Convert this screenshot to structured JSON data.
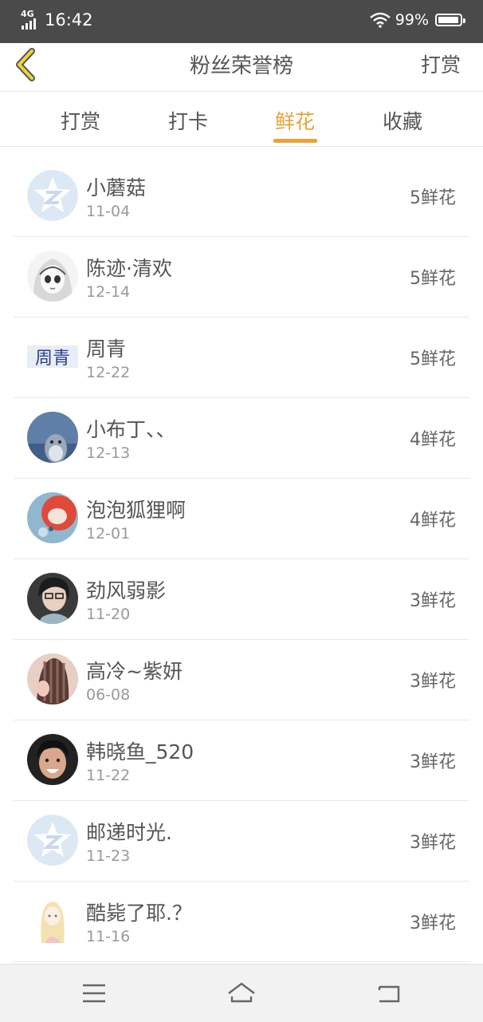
{
  "status_bar": {
    "network": "4G",
    "time": "16:42",
    "battery": "99%"
  },
  "header": {
    "title": "粉丝荣誉榜",
    "action": "打赏"
  },
  "tabs": [
    {
      "label": "打赏",
      "active": false
    },
    {
      "label": "打卡",
      "active": false
    },
    {
      "label": "鲜花",
      "active": true
    },
    {
      "label": "收藏",
      "active": false
    }
  ],
  "accent_color": "#e8a33a",
  "fans": [
    {
      "name": "小蘑菇",
      "date": "11-04",
      "amount": "5鲜花",
      "avatar": "qq-default-avatar"
    },
    {
      "name": "陈迹·清欢",
      "date": "12-14",
      "amount": "5鲜花",
      "avatar": "anime-girl-sketch-avatar"
    },
    {
      "name": "周青",
      "date": "12-22",
      "amount": "5鲜花",
      "avatar": "text-avatar",
      "avatar_text": "周青"
    },
    {
      "name": "小布丁、、",
      "date": "12-13",
      "amount": "4鲜花",
      "avatar": "totoro-avatar"
    },
    {
      "name": "泡泡狐狸啊",
      "date": "12-01",
      "amount": "4鲜花",
      "avatar": "fox-avatar"
    },
    {
      "name": "劲风弱影",
      "date": "11-20",
      "amount": "3鲜花",
      "avatar": "glasses-person-avatar"
    },
    {
      "name": "高冷~紫妍",
      "date": "06-08",
      "amount": "3鲜花",
      "avatar": "braided-hair-avatar"
    },
    {
      "name": "韩晓鱼_520",
      "date": "11-22",
      "amount": "3鲜花",
      "avatar": "smiling-boy-avatar"
    },
    {
      "name": "邮递时光.",
      "date": "11-23",
      "amount": "3鲜花",
      "avatar": "qq-default-avatar"
    },
    {
      "name": "酷毙了耶.？",
      "date": "11-16",
      "amount": "3鲜花",
      "avatar": "blonde-doll-avatar"
    }
  ]
}
